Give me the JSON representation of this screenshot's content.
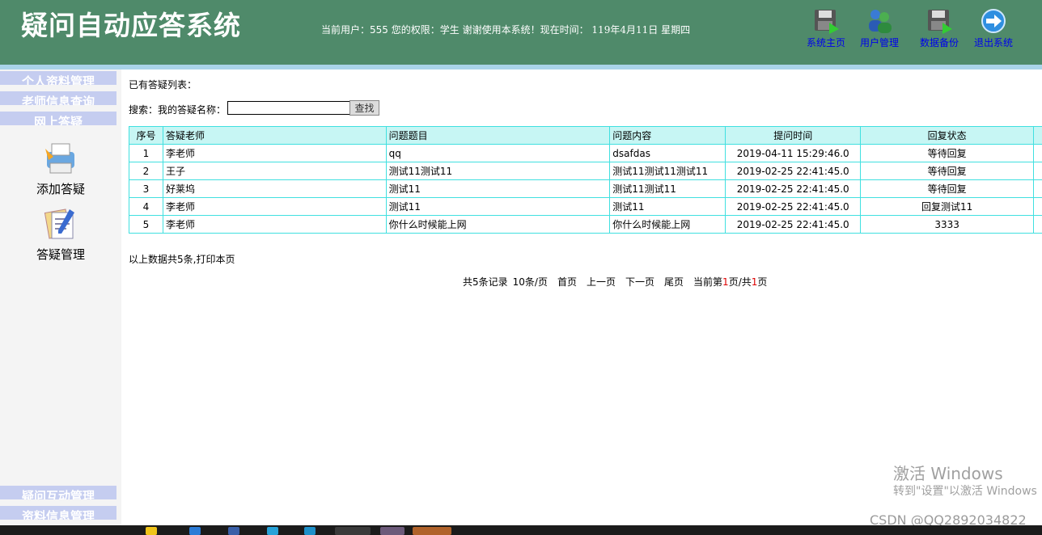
{
  "header": {
    "title": "疑问自动应答系统",
    "user_prefix": "当前用户：",
    "user": "555",
    "perm_prefix": " 您的权限：",
    "role": "学生",
    "thanks": " 谢谢使用本系统！现在时间：",
    "date": "119年4月11日",
    "weekday": "星期四",
    "buttons": [
      {
        "label": "系统主页",
        "icon": "disk-home-icon"
      },
      {
        "label": "用户管理",
        "icon": "users-icon"
      },
      {
        "label": "数据备份",
        "icon": "disk-backup-icon"
      },
      {
        "label": "退出系统",
        "icon": "arrow-exit-icon"
      }
    ]
  },
  "sidebar": {
    "menus_top": [
      "个人资料管理",
      "老师信息查询",
      "网上答疑"
    ],
    "items": [
      {
        "label": "添加答疑",
        "icon": "printer-icon"
      },
      {
        "label": "答疑管理",
        "icon": "documents-icon"
      }
    ],
    "menus_bottom": [
      "疑问互动管理",
      "资料信息管理"
    ]
  },
  "main": {
    "list_title": "已有答疑列表：",
    "search_label": "搜索：我的答疑名称：",
    "search_value": "",
    "search_button": "查找",
    "columns": [
      "序号",
      "答疑老师",
      "问题题目",
      "问题内容",
      "提问时间",
      "回复状态"
    ],
    "rows": [
      [
        "1",
        "李老师",
        "qq",
        "dsafdas",
        "2019-04-11 15:29:46.0",
        "等待回复"
      ],
      [
        "2",
        "王子",
        "测试11测试11",
        "测试11测试11测试11",
        "2019-02-25 22:41:45.0",
        "等待回复"
      ],
      [
        "3",
        "好莱坞",
        "测试11",
        "测试11测试11",
        "2019-02-25 22:41:45.0",
        "等待回复"
      ],
      [
        "4",
        "李老师",
        "测试11",
        "测试11",
        "2019-02-25 22:41:45.0",
        "回复测试11"
      ],
      [
        "5",
        "李老师",
        "你什么时候能上网",
        "你什么时候能上网",
        "2019-02-25 22:41:45.0",
        "3333"
      ]
    ],
    "summary_prefix": "以上数据共5条,",
    "print_link": "打印本页",
    "pager": {
      "total": "共5条记录",
      "per_page": "10条/页",
      "first": "首页",
      "prev": "上一页",
      "next": "下一页",
      "last": "尾页",
      "current_prefix": "当前第",
      "current": "1",
      "mid": "页/共",
      "total_pages": "1",
      "suffix": "页"
    }
  },
  "overlay": {
    "activate_title": "激活 Windows",
    "activate_hint": "转到\"设置\"以激活 Windows",
    "csdn": "CSDN @QQ2892034822"
  },
  "colors": {
    "header_bg": "#4f8a6a",
    "menu_bar": "#c5cdf0",
    "table_border": "#40e0e0",
    "table_head": "#c7f6f4"
  }
}
